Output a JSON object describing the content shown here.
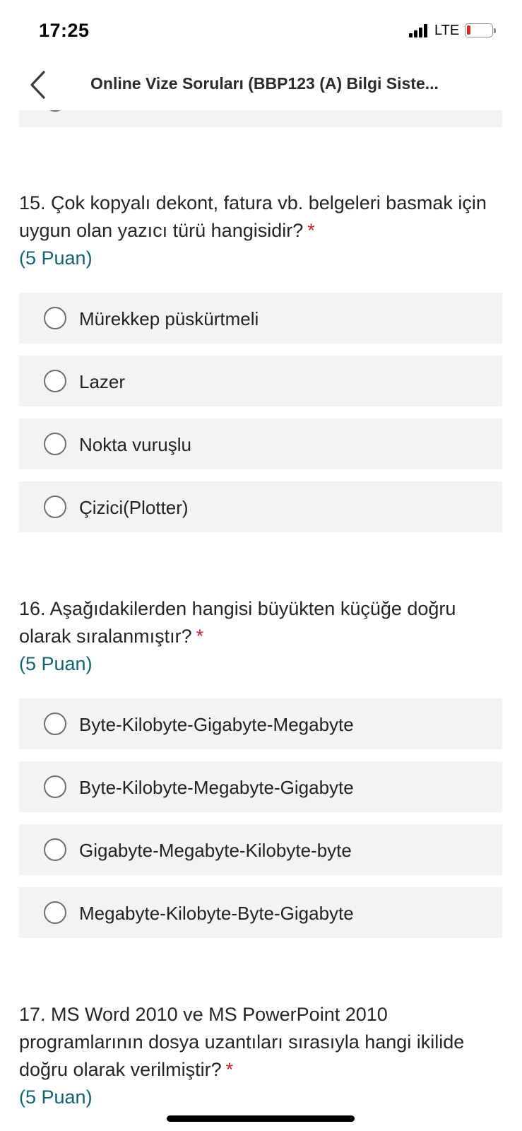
{
  "status_bar": {
    "time": "17:25",
    "network": "LTE",
    "icons": [
      "signal-icon",
      "battery-icon"
    ]
  },
  "nav": {
    "back_icon": "chevron-left-icon",
    "title": "Online Vize Soruları (BBP123 (A) Bilgi Siste..."
  },
  "colors": {
    "required": "#c4262e",
    "points": "#116372",
    "option_bg": "#f3f3f3"
  },
  "questions": [
    {
      "text": "15. Çok kopyalı dekont, fatura vb. belgeleri basmak için uygun olan yazıcı türü hangisidir?",
      "required_mark": "*",
      "points": "(5 Puan)",
      "options": [
        "Mürekkep püskürtmeli",
        "Lazer",
        "Nokta vuruşlu",
        "Çizici(Plotter)"
      ]
    },
    {
      "text": "16. Aşağıdakilerden hangisi büyükten küçüğe doğru olarak sıralanmıştır?",
      "required_mark": "*",
      "points": "(5 Puan)",
      "options": [
        "Byte-Kilobyte-Gigabyte-Megabyte",
        "Byte-Kilobyte-Megabyte-Gigabyte",
        "Gigabyte-Megabyte-Kilobyte-byte",
        "Megabyte-Kilobyte-Byte-Gigabyte"
      ]
    },
    {
      "text": "17. MS Word 2010 ve MS PowerPoint 2010 programlarının dosya uzantıları sırasıyla hangi ikilide doğru olarak verilmiştir?",
      "required_mark": "*",
      "points": "(5 Puan)"
    }
  ]
}
